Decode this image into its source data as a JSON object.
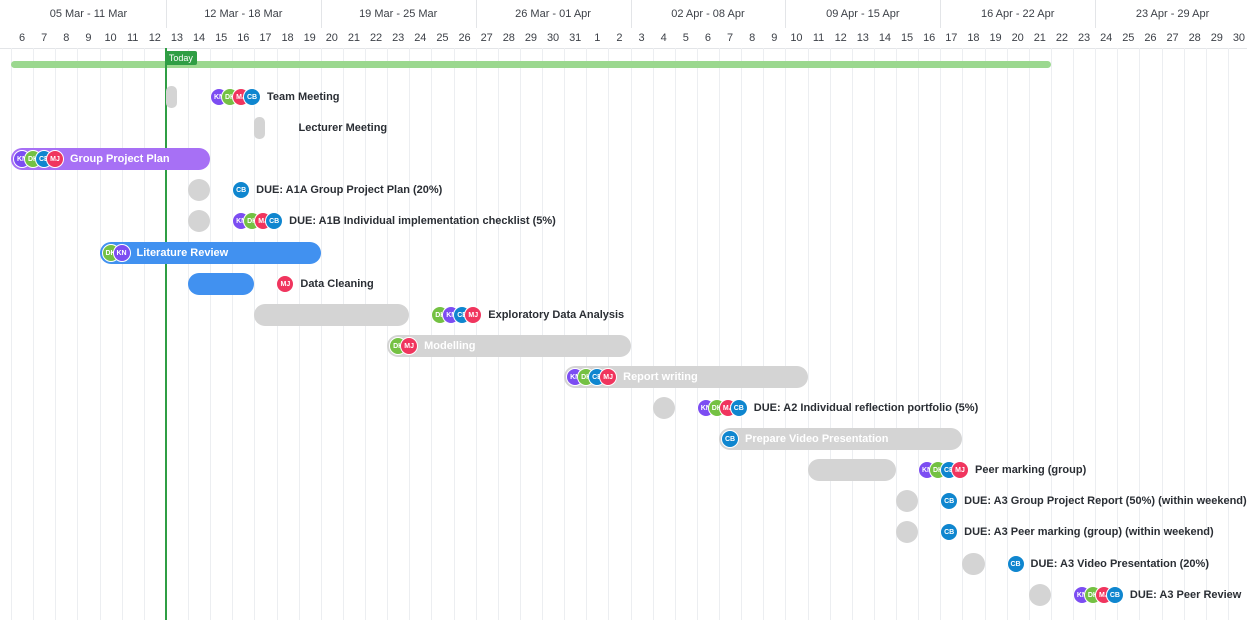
{
  "timeline": {
    "weeks": [
      "05 Mar - 11 Mar",
      "12 Mar - 18 Mar",
      "19 Mar - 25 Mar",
      "26 Mar - 01 Apr",
      "02 Apr - 08 Apr",
      "09 Apr - 15 Apr",
      "16 Apr - 22 Apr",
      "23 Apr - 29 Apr"
    ],
    "days": [
      "6",
      "7",
      "8",
      "9",
      "10",
      "11",
      "12",
      "13",
      "14",
      "15",
      "16",
      "17",
      "18",
      "19",
      "20",
      "21",
      "22",
      "23",
      "24",
      "25",
      "26",
      "27",
      "28",
      "29",
      "30",
      "31",
      "1",
      "2",
      "3",
      "4",
      "5",
      "6",
      "7",
      "8",
      "9",
      "10",
      "11",
      "12",
      "13",
      "14",
      "15",
      "16",
      "17",
      "18",
      "19",
      "20",
      "21",
      "22",
      "23",
      "24",
      "25",
      "26",
      "27",
      "28",
      "29",
      "30"
    ],
    "today_label": "Today"
  },
  "colors": {
    "today": "#2f9e44",
    "progress": "#9bd88f",
    "purple": "#a770f5",
    "blue": "#4191f0",
    "gray": "#d4d4d4"
  },
  "assignees": {
    "KN": "#7c4df2",
    "DK": "#74c143",
    "CB": "#0f86cf",
    "MJ": "#f0355e"
  },
  "tasks": [
    {
      "name": "Team Meeting",
      "start": 7,
      "end": 8,
      "color": "gray",
      "label_inside": false,
      "assignees": [
        "KN",
        "DK",
        "MJ",
        "CB"
      ]
    },
    {
      "name": "Lecturer Meeting",
      "start": 11,
      "end": 12,
      "color": "gray",
      "label_inside": false,
      "assignees": []
    },
    {
      "name": "Group Project Plan",
      "start": 0,
      "end": 9,
      "color": "purple",
      "label_inside": true,
      "assignees": [
        "KN",
        "DK",
        "CB",
        "MJ"
      ]
    },
    {
      "name": "DUE: A1A Group Project Plan (20%)",
      "start": 8,
      "end": 9,
      "color": "gray",
      "label_inside": false,
      "assignees": [
        "CB"
      ]
    },
    {
      "name": "DUE: A1B Individual implementation checklist (5%)",
      "start": 8,
      "end": 9,
      "color": "gray",
      "label_inside": false,
      "assignees": [
        "KN",
        "DK",
        "MJ",
        "CB"
      ]
    },
    {
      "name": "Literature Review",
      "start": 4,
      "end": 14,
      "color": "blue",
      "label_inside": true,
      "assignees": [
        "DK",
        "KN"
      ]
    },
    {
      "name": "Data Cleaning",
      "start": 8,
      "end": 11,
      "color": "blue",
      "label_inside": false,
      "assignees": [
        "MJ"
      ]
    },
    {
      "name": "Exploratory Data Analysis",
      "start": 11,
      "end": 18,
      "color": "gray",
      "label_inside": false,
      "assignees": [
        "DK",
        "KN",
        "CB",
        "MJ"
      ]
    },
    {
      "name": "Modelling",
      "start": 17,
      "end": 28,
      "color": "gray",
      "label_inside": true,
      "assignees": [
        "DK",
        "MJ"
      ]
    },
    {
      "name": "Report writing",
      "start": 25,
      "end": 36,
      "color": "gray",
      "label_inside": true,
      "assignees": [
        "KN",
        "DK",
        "CB",
        "MJ"
      ]
    },
    {
      "name": "DUE: A2 Individual reflection portfolio (5%)",
      "start": 29,
      "end": 30,
      "color": "gray",
      "label_inside": false,
      "assignees": [
        "KN",
        "DK",
        "MJ",
        "CB"
      ]
    },
    {
      "name": "Prepare Video Presentation",
      "start": 32,
      "end": 43,
      "color": "gray",
      "label_inside": true,
      "assignees": [
        "CB"
      ]
    },
    {
      "name": "Peer marking (group)",
      "start": 36,
      "end": 40,
      "color": "gray",
      "label_inside": false,
      "assignees": [
        "KN",
        "DK",
        "CB",
        "MJ"
      ]
    },
    {
      "name": "DUE: A3 Group Project Report (50%) (within weekend)",
      "start": 40,
      "end": 41,
      "color": "gray",
      "label_inside": false,
      "assignees": [
        "CB"
      ]
    },
    {
      "name": "DUE: A3 Peer marking (group) (within weekend)",
      "start": 40,
      "end": 41,
      "color": "gray",
      "label_inside": false,
      "assignees": [
        "CB"
      ]
    },
    {
      "name": "DUE: A3 Video Presentation (20%)",
      "start": 43,
      "end": 44,
      "color": "gray",
      "label_inside": false,
      "assignees": [
        "CB"
      ]
    },
    {
      "name": "DUE: A3 Peer Review",
      "start": 46,
      "end": 47,
      "color": "gray",
      "label_inside": false,
      "assignees": [
        "KN",
        "DK",
        "MJ",
        "CB"
      ]
    }
  ]
}
